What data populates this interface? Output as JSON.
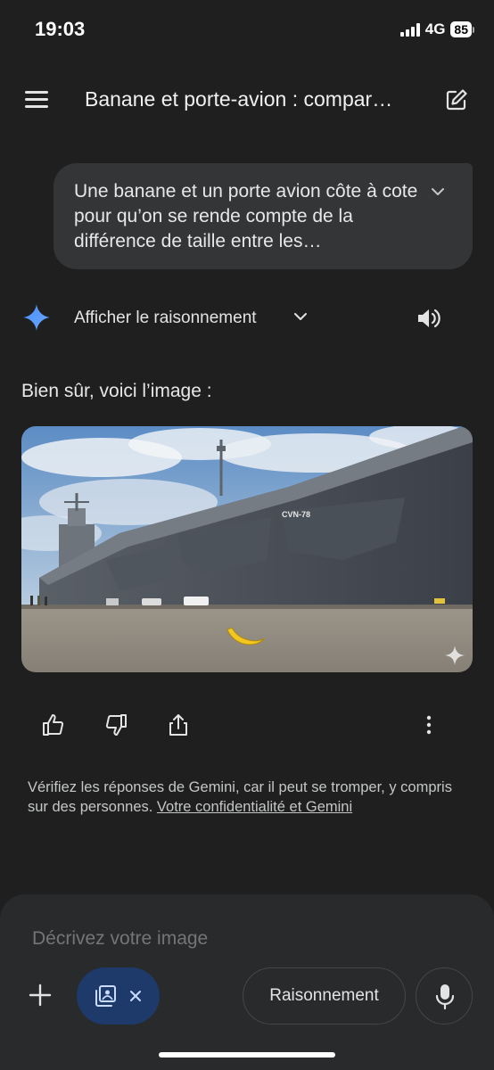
{
  "status": {
    "time": "19:03",
    "network": "4G",
    "battery": "85"
  },
  "header": {
    "title": "Banane et porte-avion : compar…"
  },
  "user_message": {
    "text": "Une banane et un porte avion côte à cote pour qu’on se rende compte de la différence de taille entre les…"
  },
  "response": {
    "reasoning_label": "Afficher le raisonnement",
    "text": "Bien sûr, voici l’image :",
    "image": {
      "hull_number": "CVN-78"
    }
  },
  "disclaimer": {
    "text": "Vérifiez les réponses de Gemini, car il peut se tromper, y compris sur des personnes. ",
    "link": "Votre confidentialité et Gemini"
  },
  "composer": {
    "placeholder": "Décrivez votre image",
    "reasoning_button": "Raisonnement"
  },
  "colors": {
    "background": "#1f1f1f",
    "bubble": "#333537",
    "chip": "#1e3a6b",
    "composer": "#282a2c"
  }
}
